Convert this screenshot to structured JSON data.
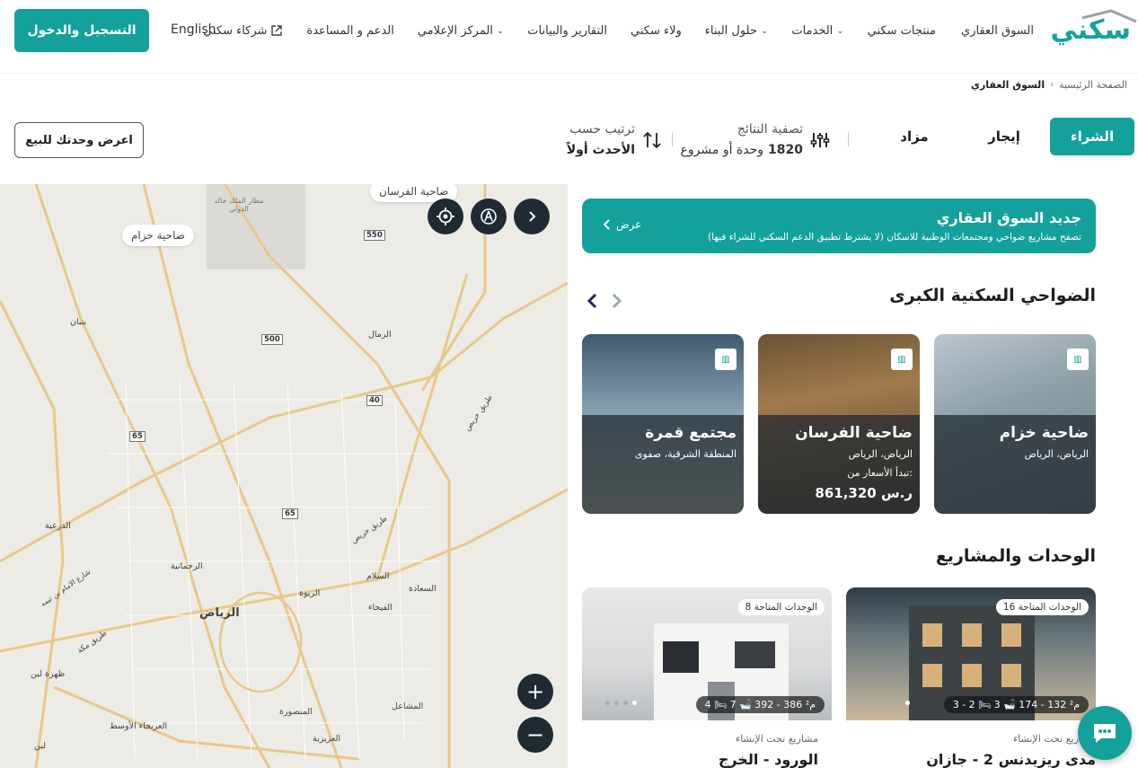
{
  "brand": {
    "logo_text": "سكني",
    "accent": "#14a19c"
  },
  "nav": {
    "items": [
      {
        "label": "السوق العقاري",
        "dropdown": false
      },
      {
        "label": "منتجات سكني",
        "dropdown": false
      },
      {
        "label": "الخدمات",
        "dropdown": true
      },
      {
        "label": "حلول البناء",
        "dropdown": true
      },
      {
        "label": "ولاء سكني",
        "dropdown": false
      },
      {
        "label": "التقارير والبيانات",
        "dropdown": false
      },
      {
        "label": "المركز الإعلامي",
        "dropdown": true
      },
      {
        "label": "الدعم و المساعدة",
        "dropdown": false
      },
      {
        "label": "شركاء سكني",
        "dropdown": false,
        "external": true
      }
    ],
    "language": "English",
    "register_label": "التسجيل والدخول"
  },
  "breadcrumb": {
    "home": "الصفحة الرئيسية",
    "separator": "›",
    "current": "السوق العقاري"
  },
  "toolbar": {
    "tabs": {
      "buy": "الشراء",
      "rent": "إيجار",
      "auction": "مزاد"
    },
    "filter_title": "تصفية النتائج",
    "results_count": "1820",
    "results_suffix": "وحدة أو مشروع",
    "sort_title": "ترتيب حسب",
    "sort_value": "الأحدث أولاً",
    "offer_button": "اعرض وحدتك للبيع"
  },
  "map": {
    "pills": [
      "ضاحية خزام",
      "ضاحية الفرسان"
    ],
    "airport": "مطار الملك خالد الدولي",
    "districts": [
      "بنبان",
      "الرمال",
      "الدرعية",
      "الرحمانية",
      "الرياض",
      "الريوة",
      "السلام",
      "السعادة",
      "الفيحاء",
      "ظهرة لبن",
      "العريجاء الأوسط",
      "المنصورة",
      "المشاعل",
      "العزيزية",
      "لبن"
    ],
    "roads": [
      "طريق خريص",
      "طريق خريص",
      "طريق مكة",
      "شارع الامام بن تيمه"
    ],
    "shields": [
      "550",
      "500",
      "40",
      "65",
      "65"
    ],
    "zoom_in": "+",
    "zoom_out": "−"
  },
  "banner": {
    "title": "جديد السوق العقاري",
    "subtitle": "تصفح مشاريع ضواحي ومجتمعات الوطنية للاسكان (لا يشترط تطبيق الدعم السكني للشراء فيها)",
    "link": "عرض"
  },
  "suburbs": {
    "title": "الضواحي السكنية الكبرى",
    "cards": [
      {
        "name": "ضاحية خزام",
        "location": "الرياض، الرياض",
        "price_label": "",
        "price": ""
      },
      {
        "name": "ضاحية الفرسان",
        "location": "الرياض، الرياض",
        "price_label": "تبدأ الأسعار من:",
        "price": "861,320 ر.س"
      },
      {
        "name": "مجتمع قمرة",
        "location": "المنطقة الشرقية، صفوى",
        "price_label": "",
        "price": ""
      }
    ]
  },
  "units": {
    "title": "الوحدات والمشاريع",
    "items": [
      {
        "available": "الوحدات المتاحة 16",
        "specs": "3 - 2  🛏   3 🛁   174 - 132 م²",
        "status": "مشاريع تحت الإنشاء",
        "name": "مدى ريزيدنس 2 - جازان"
      },
      {
        "available": "الوحدات المتاحة 8",
        "specs": "4 🛏   7 🛁   392 - 386 م²",
        "status": "مشاريع تحت الإنشاء",
        "name": "الورود - الخرج"
      }
    ]
  }
}
